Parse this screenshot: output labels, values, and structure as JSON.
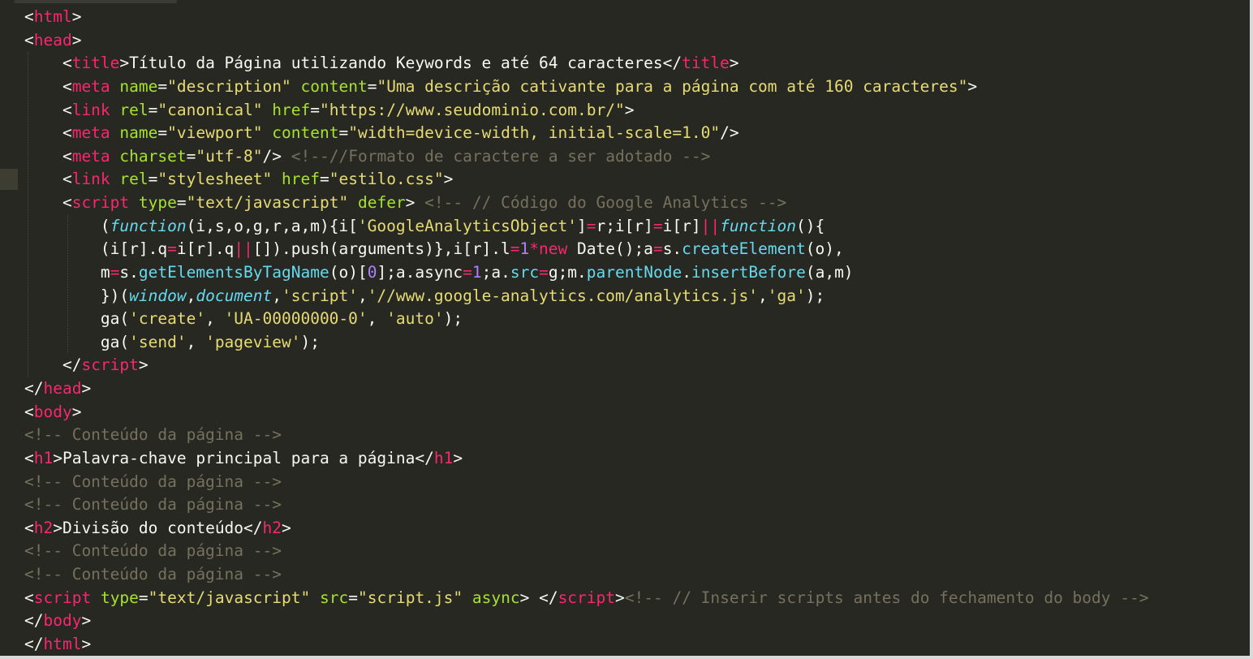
{
  "colors": {
    "background": "#272822",
    "tag": "#f92672",
    "attribute": "#a6e22e",
    "string": "#e6db74",
    "comment": "#75715e",
    "keyword": "#66d9ef",
    "number": "#ae81ff",
    "text": "#f8f8f2"
  },
  "editor": {
    "lines": [
      [
        [
          "pl",
          "<"
        ],
        [
          "tag",
          "html"
        ],
        [
          "pl",
          ">"
        ]
      ],
      [
        [
          "pl",
          "<"
        ],
        [
          "tag",
          "head"
        ],
        [
          "pl",
          ">"
        ]
      ],
      [
        [
          "pl",
          "    <"
        ],
        [
          "tag",
          "title"
        ],
        [
          "pl",
          ">Título da Página utilizando Keywords e até 64 caracteres</"
        ],
        [
          "tag",
          "title"
        ],
        [
          "pl",
          ">"
        ]
      ],
      [
        [
          "pl",
          "    <"
        ],
        [
          "tag",
          "meta"
        ],
        [
          "pl",
          " "
        ],
        [
          "attr",
          "name"
        ],
        [
          "pl",
          "="
        ],
        [
          "str",
          "\"description\""
        ],
        [
          "pl",
          " "
        ],
        [
          "attr",
          "content"
        ],
        [
          "pl",
          "="
        ],
        [
          "str",
          "\"Uma descrição cativante para a página com até 160 caracteres\""
        ],
        [
          "pl",
          ">"
        ]
      ],
      [
        [
          "pl",
          "    <"
        ],
        [
          "tag",
          "link"
        ],
        [
          "pl",
          " "
        ],
        [
          "attr",
          "rel"
        ],
        [
          "pl",
          "="
        ],
        [
          "str",
          "\"canonical\""
        ],
        [
          "pl",
          " "
        ],
        [
          "attr",
          "href"
        ],
        [
          "pl",
          "="
        ],
        [
          "str",
          "\"https://www.seudominio.com.br/\""
        ],
        [
          "pl",
          ">"
        ]
      ],
      [
        [
          "pl",
          "    <"
        ],
        [
          "tag",
          "meta"
        ],
        [
          "pl",
          " "
        ],
        [
          "attr",
          "name"
        ],
        [
          "pl",
          "="
        ],
        [
          "str",
          "\"viewport\""
        ],
        [
          "pl",
          " "
        ],
        [
          "attr",
          "content"
        ],
        [
          "pl",
          "="
        ],
        [
          "str",
          "\"width=device-width, initial-scale=1.0\""
        ],
        [
          "pl",
          "/>"
        ]
      ],
      [
        [
          "pl",
          "    <"
        ],
        [
          "tag",
          "meta"
        ],
        [
          "pl",
          " "
        ],
        [
          "attr",
          "charset"
        ],
        [
          "pl",
          "="
        ],
        [
          "str",
          "\"utf-8\""
        ],
        [
          "pl",
          "/> "
        ],
        [
          "cmt",
          "<!--//Formato de caractere a ser adotado -->"
        ]
      ],
      [
        [
          "pl",
          "    <"
        ],
        [
          "tag",
          "link"
        ],
        [
          "pl",
          " "
        ],
        [
          "attr",
          "rel"
        ],
        [
          "pl",
          "="
        ],
        [
          "str",
          "\"stylesheet\""
        ],
        [
          "pl",
          " "
        ],
        [
          "attr",
          "href"
        ],
        [
          "pl",
          "="
        ],
        [
          "str",
          "\"estilo.css\""
        ],
        [
          "pl",
          ">"
        ]
      ],
      [
        [
          "pl",
          "    <"
        ],
        [
          "tag",
          "script"
        ],
        [
          "pl",
          " "
        ],
        [
          "attr",
          "type"
        ],
        [
          "pl",
          "="
        ],
        [
          "str",
          "\"text/javascript\""
        ],
        [
          "pl",
          " "
        ],
        [
          "attr",
          "defer"
        ],
        [
          "pl",
          "> "
        ],
        [
          "cmt",
          "<!-- // Código do Google Analytics -->"
        ]
      ],
      [
        [
          "pl",
          "        ("
        ],
        [
          "kw",
          "function"
        ],
        [
          "pl",
          "(i,s,o,g,r,a,m){i["
        ],
        [
          "str",
          "'GoogleAnalyticsObject'"
        ],
        [
          "pl",
          "]"
        ],
        [
          "op",
          "="
        ],
        [
          "pl",
          "r;i[r]"
        ],
        [
          "op",
          "="
        ],
        [
          "pl",
          "i[r]"
        ],
        [
          "op",
          "||"
        ],
        [
          "kw",
          "function"
        ],
        [
          "pl",
          "(){"
        ]
      ],
      [
        [
          "pl",
          "        (i[r].q"
        ],
        [
          "op",
          "="
        ],
        [
          "pl",
          "i[r].q"
        ],
        [
          "op",
          "||"
        ],
        [
          "pl",
          "[]).push(arguments)},i[r].l"
        ],
        [
          "op",
          "="
        ],
        [
          "num",
          "1"
        ],
        [
          "op",
          "*"
        ],
        [
          "op",
          "new"
        ],
        [
          "pl",
          " Date();a"
        ],
        [
          "op",
          "="
        ],
        [
          "pl",
          "s."
        ],
        [
          "fn",
          "createElement"
        ],
        [
          "pl",
          "(o),"
        ]
      ],
      [
        [
          "pl",
          "        m"
        ],
        [
          "op",
          "="
        ],
        [
          "pl",
          "s."
        ],
        [
          "fn",
          "getElementsByTagName"
        ],
        [
          "pl",
          "(o)["
        ],
        [
          "num",
          "0"
        ],
        [
          "pl",
          "];a.async"
        ],
        [
          "op",
          "="
        ],
        [
          "num",
          "1"
        ],
        [
          "pl",
          ";a."
        ],
        [
          "fn",
          "src"
        ],
        [
          "op",
          "="
        ],
        [
          "pl",
          "g;m."
        ],
        [
          "fn",
          "parentNode"
        ],
        [
          "pl",
          "."
        ],
        [
          "fn",
          "insertBefore"
        ],
        [
          "pl",
          "(a,m)"
        ]
      ],
      [
        [
          "pl",
          "        })("
        ],
        [
          "kw",
          "window"
        ],
        [
          "pl",
          ","
        ],
        [
          "kw",
          "document"
        ],
        [
          "pl",
          ","
        ],
        [
          "str",
          "'script'"
        ],
        [
          "pl",
          ","
        ],
        [
          "str",
          "'//www.google-analytics.com/analytics.js'"
        ],
        [
          "pl",
          ","
        ],
        [
          "str",
          "'ga'"
        ],
        [
          "pl",
          ");"
        ]
      ],
      [
        [
          "pl",
          "        ga("
        ],
        [
          "str",
          "'create'"
        ],
        [
          "pl",
          ", "
        ],
        [
          "str",
          "'UA-00000000-0'"
        ],
        [
          "pl",
          ", "
        ],
        [
          "str",
          "'auto'"
        ],
        [
          "pl",
          ");"
        ]
      ],
      [
        [
          "pl",
          "        ga("
        ],
        [
          "str",
          "'send'"
        ],
        [
          "pl",
          ", "
        ],
        [
          "str",
          "'pageview'"
        ],
        [
          "pl",
          ");"
        ]
      ],
      [
        [
          "pl",
          "    </"
        ],
        [
          "tag",
          "script"
        ],
        [
          "pl",
          ">"
        ]
      ],
      [
        [
          "pl",
          "</"
        ],
        [
          "tag",
          "head"
        ],
        [
          "pl",
          ">"
        ]
      ],
      [
        [
          "pl",
          "<"
        ],
        [
          "tag",
          "body"
        ],
        [
          "pl",
          ">"
        ]
      ],
      [
        [
          "cmt",
          "<!-- Conteúdo da página -->"
        ]
      ],
      [
        [
          "pl",
          "<"
        ],
        [
          "tag",
          "h1"
        ],
        [
          "pl",
          ">Palavra-chave principal para a página</"
        ],
        [
          "tag",
          "h1"
        ],
        [
          "pl",
          ">"
        ]
      ],
      [
        [
          "cmt",
          "<!-- Conteúdo da página -->"
        ]
      ],
      [
        [
          "cmt",
          "<!-- Conteúdo da página -->"
        ]
      ],
      [
        [
          "pl",
          "<"
        ],
        [
          "tag",
          "h2"
        ],
        [
          "pl",
          ">Divisão do conteúdo</"
        ],
        [
          "tag",
          "h2"
        ],
        [
          "pl",
          ">"
        ]
      ],
      [
        [
          "cmt",
          "<!-- Conteúdo da página -->"
        ]
      ],
      [
        [
          "cmt",
          "<!-- Conteúdo da página -->"
        ]
      ],
      [
        [
          "pl",
          "<"
        ],
        [
          "tag",
          "script"
        ],
        [
          "pl",
          " "
        ],
        [
          "attr",
          "type"
        ],
        [
          "pl",
          "="
        ],
        [
          "str",
          "\"text/javascript\""
        ],
        [
          "pl",
          " "
        ],
        [
          "attr",
          "src"
        ],
        [
          "pl",
          "="
        ],
        [
          "str",
          "\"script.js\""
        ],
        [
          "pl",
          " "
        ],
        [
          "attr",
          "async"
        ],
        [
          "pl",
          "> </"
        ],
        [
          "tag",
          "script"
        ],
        [
          "pl",
          ">"
        ],
        [
          "cmt",
          "<!-- // Inserir scripts antes do fechamento do body -->"
        ]
      ],
      [
        [
          "pl",
          "</"
        ],
        [
          "tag",
          "body"
        ],
        [
          "pl",
          ">"
        ]
      ],
      [
        [
          "pl",
          "</"
        ],
        [
          "tag",
          "html"
        ],
        [
          "pl",
          ">"
        ]
      ]
    ]
  }
}
